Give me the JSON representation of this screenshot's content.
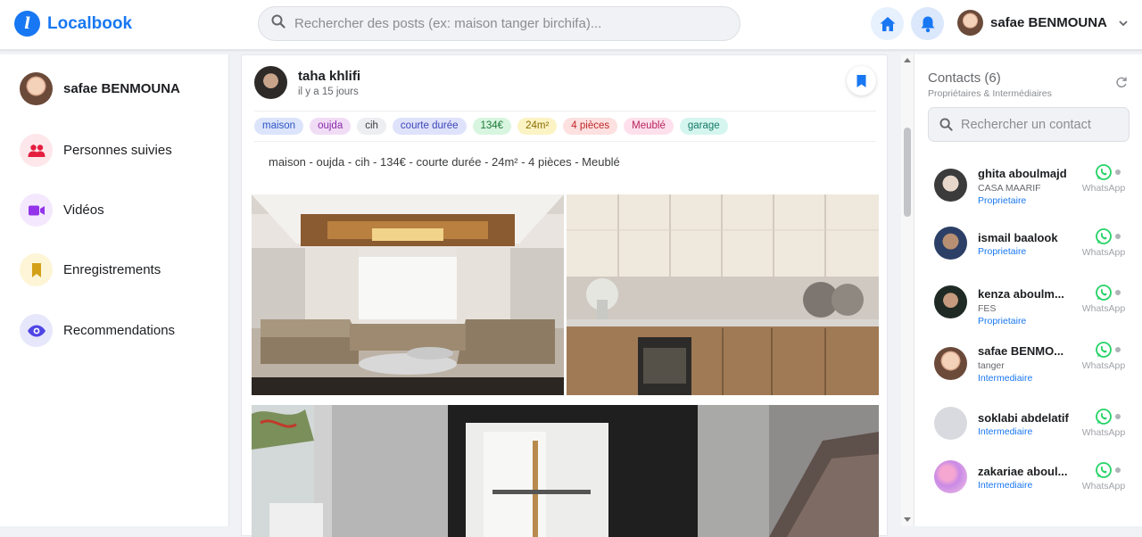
{
  "app": {
    "name": "Localbook",
    "logo_letter": "l",
    "brand_color": "#1877f2"
  },
  "header": {
    "search_placeholder": "Rechercher des posts (ex: maison tanger birchifa)...",
    "user_name": "safae BENMOUNA"
  },
  "sidebar": {
    "profile_name": "safae BENMOUNA",
    "items": [
      {
        "label": "Personnes suivies",
        "icon": "people-icon",
        "color": "#e41e3f"
      },
      {
        "label": "Vidéos",
        "icon": "video-icon",
        "color": "#9333ea"
      },
      {
        "label": "Enregistrements",
        "icon": "bookmark-icon",
        "color": "#d4a017"
      },
      {
        "label": "Recommendations",
        "icon": "eye-icon",
        "color": "#4f46e5"
      }
    ]
  },
  "post": {
    "author": "taha khlifi",
    "time": "il y a 15 jours",
    "tags": [
      {
        "label": "maison",
        "bg": "#dbe4fb",
        "fg": "#2f55c5"
      },
      {
        "label": "oujda",
        "bg": "#f1dcf6",
        "fg": "#8a2ca8"
      },
      {
        "label": "cih",
        "bg": "#eceef1",
        "fg": "#3a3b3c"
      },
      {
        "label": "courte durée",
        "bg": "#dfe2fb",
        "fg": "#3b45b8"
      },
      {
        "label": "134€",
        "bg": "#d7f5df",
        "fg": "#1e7a3a"
      },
      {
        "label": "24m²",
        "bg": "#fbf3c3",
        "fg": "#8a6a00"
      },
      {
        "label": "4 pièces",
        "bg": "#fde0e0",
        "fg": "#c02626"
      },
      {
        "label": "Meublé",
        "bg": "#fde0ec",
        "fg": "#b8235f"
      },
      {
        "label": "garage",
        "bg": "#d5f5ef",
        "fg": "#137a66"
      }
    ],
    "description": "maison - oujda - cih - 134€ - courte durée - 24m² - 4 pièces - Meublé"
  },
  "contacts": {
    "title": "Contacts (6)",
    "subtitle": "Propriétaires & Intermédiaires",
    "search_placeholder": "Rechercher un contact",
    "whatsapp_label": "WhatsApp",
    "list": [
      {
        "name": "ghita aboulmajd",
        "city": "CASA MAARIF",
        "role": "Proprietaire",
        "avatar": "av-old"
      },
      {
        "name": "ismail baalook",
        "city": "",
        "role": "Proprietaire",
        "avatar": "av-man2"
      },
      {
        "name": "kenza aboulm...",
        "city": "FES",
        "role": "Proprietaire",
        "avatar": "av-girl"
      },
      {
        "name": "safae BENMO...",
        "city": "tanger",
        "role": "Intermediaire",
        "avatar": "av-woman"
      },
      {
        "name": "soklabi abdelatif",
        "city": "",
        "role": "Intermediaire",
        "avatar": "av-grey"
      },
      {
        "name": "zakariae aboul...",
        "city": "",
        "role": "Intermediaire",
        "avatar": "av-pink"
      }
    ]
  }
}
